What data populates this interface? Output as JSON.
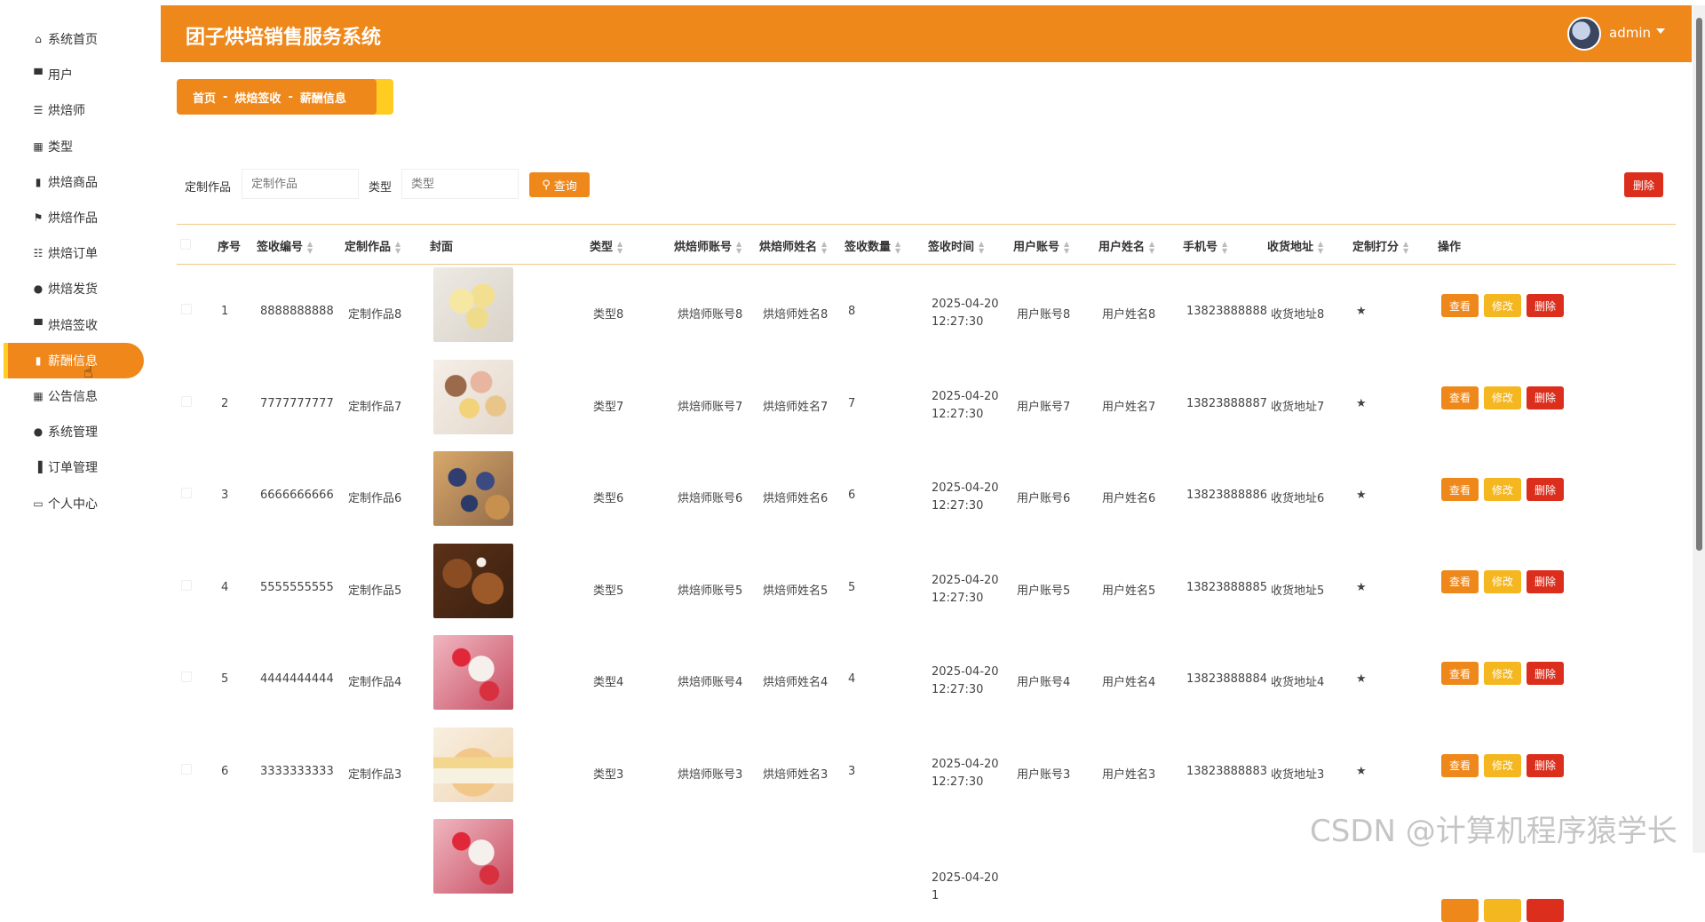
{
  "app_title": "团子烘培销售服务系统",
  "user": {
    "name": "admin"
  },
  "sidebar": {
    "items": [
      {
        "label": "系统首页",
        "icon": "home-icon",
        "glyph": "⌂",
        "active": false
      },
      {
        "label": "用户",
        "icon": "monitor-icon",
        "glyph": "▀",
        "active": false
      },
      {
        "label": "烘焙师",
        "icon": "menu-icon",
        "glyph": "☰",
        "active": false
      },
      {
        "label": "类型",
        "icon": "grid-icon",
        "glyph": "▦",
        "active": false
      },
      {
        "label": "烘焙商品",
        "icon": "clipboard-icon",
        "glyph": "▮",
        "active": false
      },
      {
        "label": "烘焙作品",
        "icon": "flag-icon",
        "glyph": "⚑",
        "active": false
      },
      {
        "label": "烘焙订单",
        "icon": "sliders-icon",
        "glyph": "☷",
        "active": false
      },
      {
        "label": "烘焙发货",
        "icon": "user-icon",
        "glyph": "●",
        "active": false
      },
      {
        "label": "烘焙签收",
        "icon": "stamp-icon",
        "glyph": "▀",
        "active": false
      },
      {
        "label": "薪酬信息",
        "icon": "clipboard-icon",
        "glyph": "▮",
        "active": true
      },
      {
        "label": "公告信息",
        "icon": "grid-icon",
        "glyph": "▦",
        "active": false
      },
      {
        "label": "系统管理",
        "icon": "person-icon",
        "glyph": "●",
        "active": false
      },
      {
        "label": "订单管理",
        "icon": "bar-chart-icon",
        "glyph": "▐",
        "active": false
      },
      {
        "label": "个人中心",
        "icon": "id-card-icon",
        "glyph": "▭",
        "active": false
      }
    ]
  },
  "breadcrumb": [
    "首页",
    "烘焙签收",
    "薪酬信息"
  ],
  "breadcrumb_sep": "-",
  "filters": [
    {
      "label": "定制作品",
      "placeholder": "定制作品"
    },
    {
      "label": "类型",
      "placeholder": "类型"
    }
  ],
  "query_label": "查询",
  "delete_all_label": "删除",
  "columns": [
    "序号",
    "签收编号",
    "定制作品",
    "封面",
    "类型",
    "烘焙师账号",
    "烘焙师姓名",
    "签收数量",
    "签收时间",
    "用户账号",
    "用户姓名",
    "手机号",
    "收货地址",
    "定制打分",
    "操作"
  ],
  "row_actions": {
    "view": "查看",
    "edit": "修改",
    "delete": "删除"
  },
  "rows": [
    {
      "idx": "1",
      "code": "8888888888",
      "work": "定制作品8",
      "cover": "cream-puffs",
      "type": "类型8",
      "baker_acct": "烘焙师账号8",
      "baker_name": "烘焙师姓名8",
      "qty": "8",
      "time": "2025-04-20 12:27:30",
      "user_acct": "用户账号8",
      "user_name": "用户姓名8",
      "phone": "13823888888",
      "addr": "收货地址8",
      "score": "★"
    },
    {
      "idx": "2",
      "code": "7777777777",
      "work": "定制作品7",
      "cover": "macarons",
      "type": "类型7",
      "baker_acct": "烘焙师账号7",
      "baker_name": "烘焙师姓名7",
      "qty": "7",
      "time": "2025-04-20 12:27:30",
      "user_acct": "用户账号7",
      "user_name": "用户姓名7",
      "phone": "13823888887",
      "addr": "收货地址7",
      "score": "★"
    },
    {
      "idx": "3",
      "code": "6666666666",
      "work": "定制作品6",
      "cover": "blueberry-tarts",
      "type": "类型6",
      "baker_acct": "烘焙师账号6",
      "baker_name": "烘焙师姓名6",
      "qty": "6",
      "time": "2025-04-20 12:27:30",
      "user_acct": "用户账号6",
      "user_name": "用户姓名6",
      "phone": "13823888886",
      "addr": "收货地址6",
      "score": "★"
    },
    {
      "idx": "4",
      "code": "5555555555",
      "work": "定制作品5",
      "cover": "gingerbread",
      "type": "类型5",
      "baker_acct": "烘焙师账号5",
      "baker_name": "烘焙师姓名5",
      "qty": "5",
      "time": "2025-04-20 12:27:30",
      "user_acct": "用户账号5",
      "user_name": "用户姓名5",
      "phone": "13823888885",
      "addr": "收货地址5",
      "score": "★"
    },
    {
      "idx": "5",
      "code": "4444444444",
      "work": "定制作品4",
      "cover": "strawberry-cups",
      "type": "类型4",
      "baker_acct": "烘焙师账号4",
      "baker_name": "烘焙师姓名4",
      "qty": "4",
      "time": "2025-04-20 12:27:30",
      "user_acct": "用户账号4",
      "user_name": "用户姓名4",
      "phone": "13823888884",
      "addr": "收货地址4",
      "score": "★"
    },
    {
      "idx": "6",
      "code": "3333333333",
      "work": "定制作品3",
      "cover": "cake-slice",
      "type": "类型3",
      "baker_acct": "烘焙师账号3",
      "baker_name": "烘焙师姓名3",
      "qty": "3",
      "time": "2025-04-20 12:27:30",
      "user_acct": "用户账号3",
      "user_name": "用户姓名3",
      "phone": "13823888883",
      "addr": "收货地址3",
      "score": "★"
    },
    {
      "idx": "",
      "code": "",
      "work": "",
      "cover": "strawberry-cups",
      "type": "",
      "baker_acct": "",
      "baker_name": "",
      "qty": "",
      "time": "2025-04-20 1",
      "user_acct": "",
      "user_name": "",
      "phone": "",
      "addr": "",
      "score": ""
    }
  ],
  "watermark": "CSDN @计算机程序猿学长",
  "colors": {
    "brand": "#ef881b",
    "accent": "#ffcc22",
    "danger": "#dc2e1c",
    "edit": "#f5b720"
  }
}
